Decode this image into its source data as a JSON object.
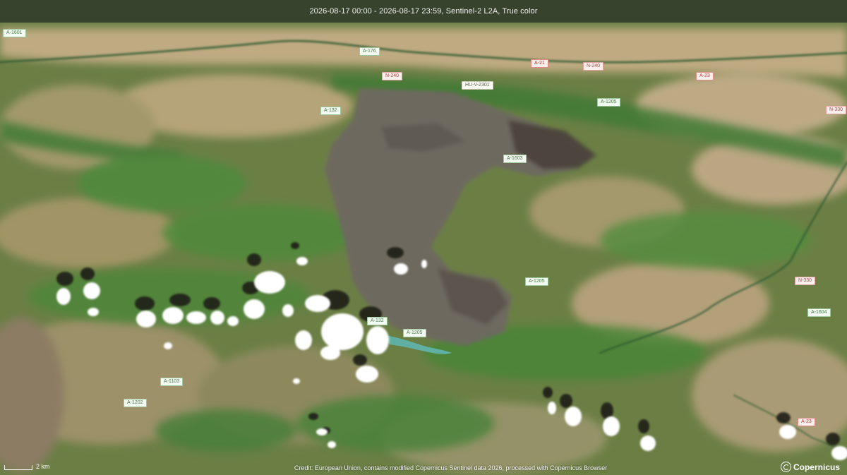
{
  "header": {
    "title": "2026-08-17 00:00 - 2026-08-17 23:59, Sentinel-2 L2A, True color"
  },
  "footer": {
    "credit": "Credit: European Union, contains modified Copernicus Sentinel data 2026, processed with Copernicus Browser",
    "scale_label": "2 km",
    "brand": "Copernicus"
  },
  "roads": {
    "a1601": "A-1601",
    "a176": "A-176",
    "n240a": "N-240",
    "a21": "A-21",
    "n240b": "N-240",
    "a23a": "A-23",
    "huv2301": "HU-V-2301",
    "a1205a": "A-1205",
    "n330a": "N-330",
    "a132a": "A-132",
    "a1603": "A-1603",
    "a1205b": "A-1205",
    "n330b": "N-330",
    "a1604": "A-1604",
    "a132b": "A-132",
    "a1205c": "A-1205",
    "a1103": "A-1103",
    "a1202": "A-1202",
    "a23b": "A-23"
  },
  "colors": {
    "burn_scar": "#6b6660",
    "vegetation": "#5e8a3e",
    "farmland": "#c9b38a",
    "reservoir": "#5fb3a8",
    "cloud": "#ffffff"
  }
}
